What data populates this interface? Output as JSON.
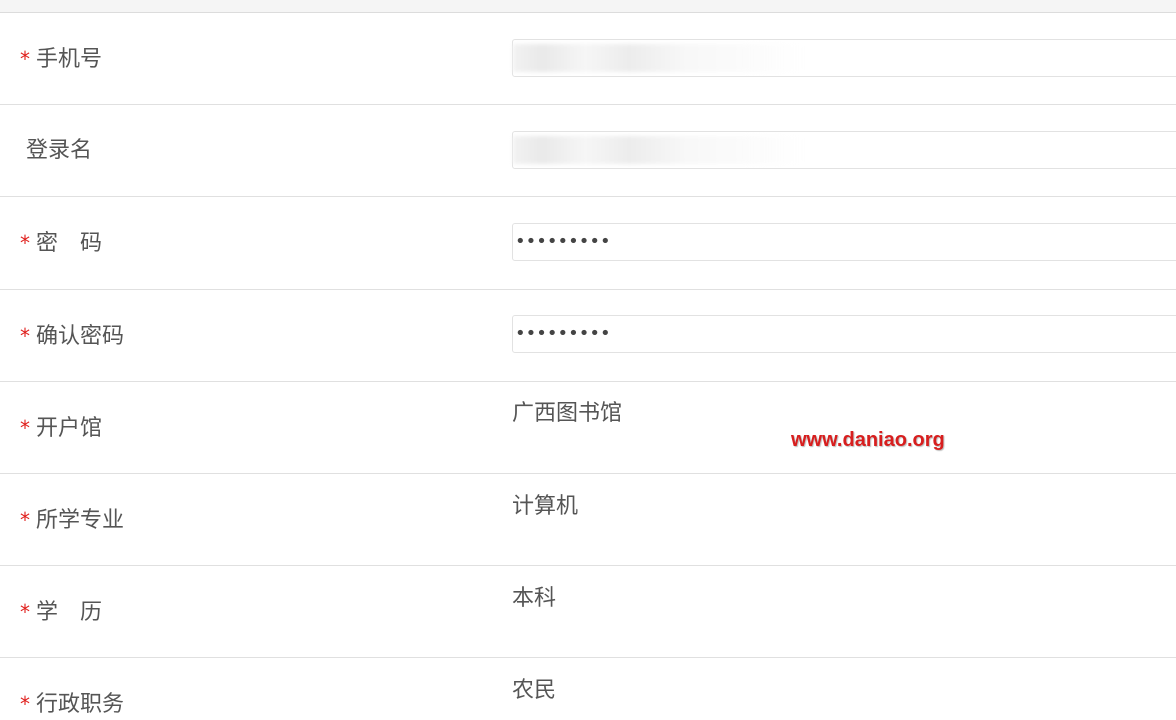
{
  "form": {
    "phone": {
      "label": "手机号",
      "required": true,
      "value": ""
    },
    "login_name": {
      "label": "登录名",
      "required": false,
      "value": ""
    },
    "password": {
      "label": "密　码",
      "required": true,
      "value": "•••••••••"
    },
    "confirm_password": {
      "label": "确认密码",
      "required": true,
      "value": "•••••••••"
    },
    "library": {
      "label": "开户馆",
      "required": true,
      "value": "广西图书馆"
    },
    "major": {
      "label": "所学专业",
      "required": true,
      "value": "计算机"
    },
    "education": {
      "label": "学　历",
      "required": true,
      "value": "本科"
    },
    "position": {
      "label": "行政职务",
      "required": true,
      "value": "农民"
    }
  },
  "required_mark": "*",
  "watermark": "www.daniao.org",
  "colors": {
    "required": "#e0201d",
    "watermark": "#d81e1e",
    "border": "#e0e0e0"
  }
}
